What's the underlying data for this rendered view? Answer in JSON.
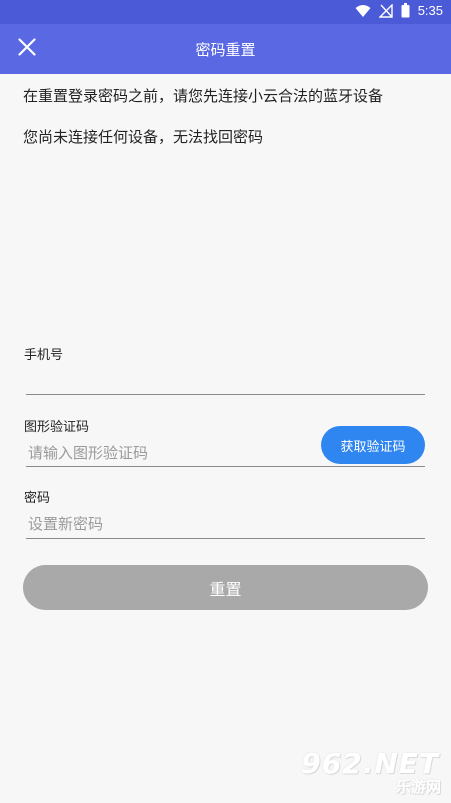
{
  "status_bar": {
    "time": "5:35",
    "icons": [
      "wifi-icon",
      "signal-off-icon",
      "battery-icon"
    ]
  },
  "app_bar": {
    "title": "密码重置",
    "close_icon": "close-icon"
  },
  "notices": {
    "line1": "在重置登录密码之前，请您先连接小云合法的蓝牙设备",
    "line2": "您尚未连接任何设备，无法找回密码"
  },
  "form": {
    "phone": {
      "label": "手机号",
      "value": "",
      "placeholder": ""
    },
    "captcha": {
      "label": "图形验证码",
      "value": "",
      "placeholder": "请输入图形验证码",
      "button_label": "获取验证码"
    },
    "password": {
      "label": "密码",
      "value": "",
      "placeholder": "设置新密码"
    },
    "submit_label": "重置"
  },
  "watermark": {
    "number": "962",
    "suffix": ".NET",
    "text": "乐游网"
  },
  "colors": {
    "status_bar": "#4b5bd8",
    "app_bar": "#5a69e3",
    "code_button": "#2f86f0",
    "reset_button_disabled": "#a9a9a9",
    "background": "#f7f7f7"
  }
}
